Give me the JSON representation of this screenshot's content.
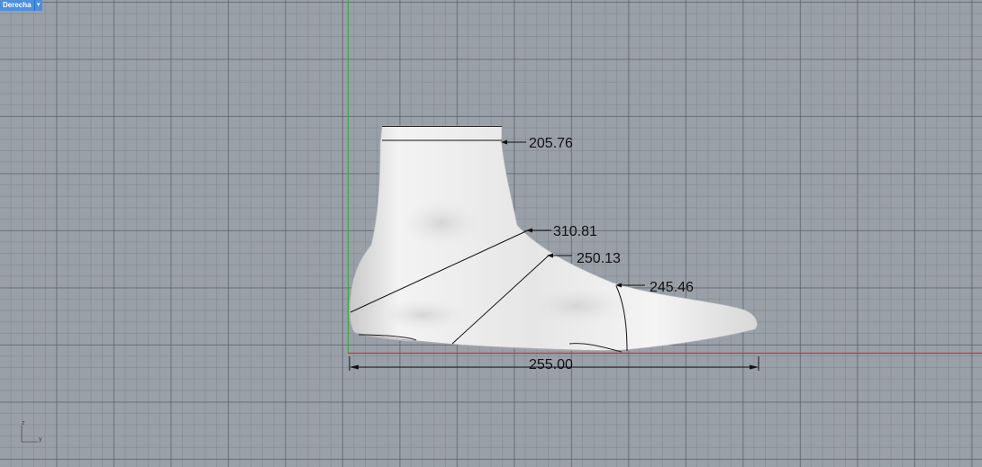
{
  "viewport": {
    "name": "Derecha",
    "menu_icon": "chevron-down-icon"
  },
  "dimensions": {
    "ankle": "205.76",
    "instep": "310.81",
    "waist": "250.13",
    "ball": "245.46",
    "length": "255.00"
  },
  "axis_widget": {
    "z_label": "z",
    "y_label": "y"
  },
  "colors": {
    "background": "#9aa0a8",
    "x_axis": "#c23a3a",
    "z_axis": "#3aa844",
    "tab": "#4a8fe2"
  }
}
